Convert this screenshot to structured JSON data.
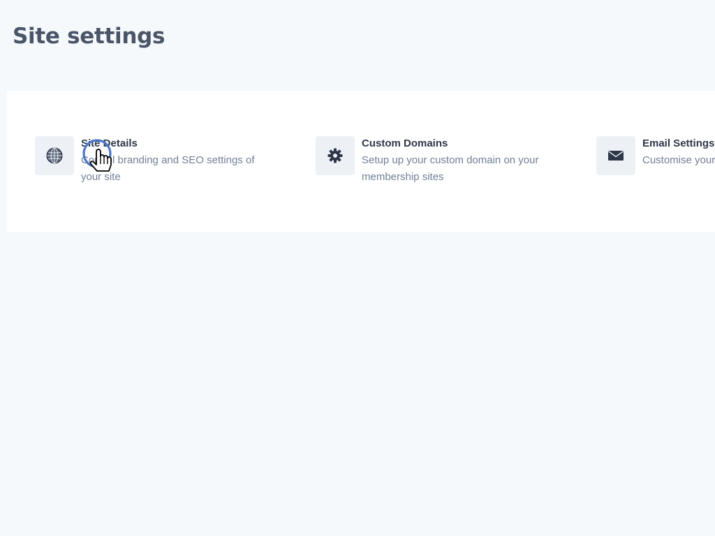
{
  "page": {
    "title": "Site settings"
  },
  "settings": {
    "items": [
      {
        "title": "Site Details",
        "description": "Control branding and SEO settings of your site",
        "icon": "globe-icon"
      },
      {
        "title": "Custom Domains",
        "description": "Setup up your custom domain on your membership sites",
        "icon": "gear-icon"
      },
      {
        "title": "Email Settings",
        "description": "Customise your email settings",
        "icon": "envelope-icon"
      }
    ]
  },
  "colors": {
    "background": "#f5f9fc",
    "card": "#ffffff",
    "icon_box": "#edf1f6",
    "title_text": "#2d3748",
    "description_text": "#718096",
    "heading_text": "#4a5568",
    "cursor_ring": "#4a78c8"
  }
}
